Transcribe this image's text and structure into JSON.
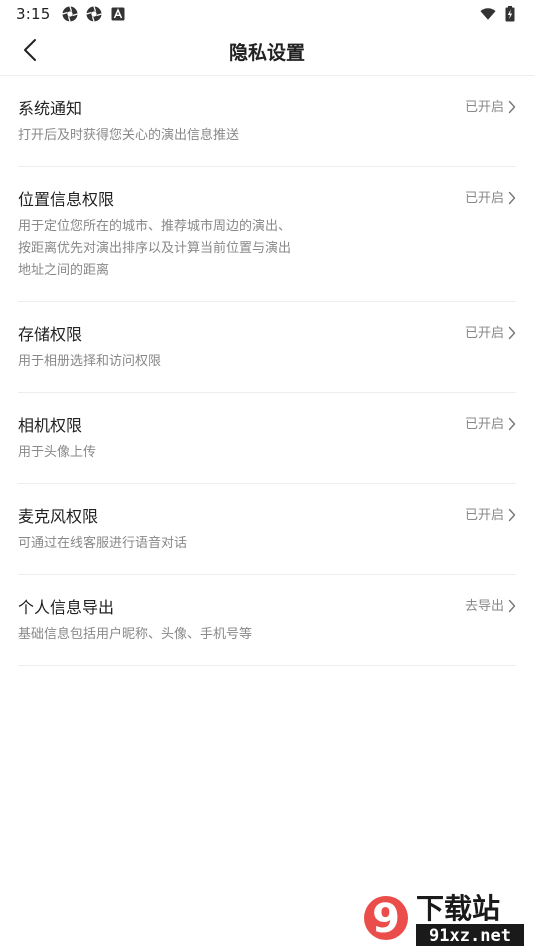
{
  "status_bar": {
    "time": "3:15",
    "left_icons": [
      "aperture-icon",
      "aperture-icon",
      "font-a-icon"
    ],
    "right_icons": [
      "wifi-icon",
      "battery-charging-icon"
    ]
  },
  "header": {
    "title": "隐私设置",
    "back_icon": "chevron-left-icon"
  },
  "items": [
    {
      "title": "系统通知",
      "desc": "打开后及时获得您关心的演出信息推送",
      "status": "已开启"
    },
    {
      "title": "位置信息权限",
      "desc": "用于定位您所在的城市、推荐城市周边的演出、按距离优先对演出排序以及计算当前位置与演出地址之间的距离",
      "status": "已开启"
    },
    {
      "title": "存储权限",
      "desc": "用于相册选择和访问权限",
      "status": "已开启"
    },
    {
      "title": "相机权限",
      "desc": "用于头像上传",
      "status": "已开启"
    },
    {
      "title": "麦克风权限",
      "desc": "可通过在线客服进行语音对话",
      "status": "已开启"
    },
    {
      "title": "个人信息导出",
      "desc": "基础信息包括用户昵称、头像、手机号等",
      "status": "去导出"
    }
  ],
  "watermark": {
    "logo_text": "9",
    "brand_text": "下载站",
    "url_text": "91xz.net",
    "colors": {
      "red": "#e83a36",
      "dark": "#1a1a1a"
    }
  },
  "colors": {
    "text_primary": "#222222",
    "text_secondary": "#888888",
    "divider": "#eeeeee",
    "background": "#ffffff"
  }
}
